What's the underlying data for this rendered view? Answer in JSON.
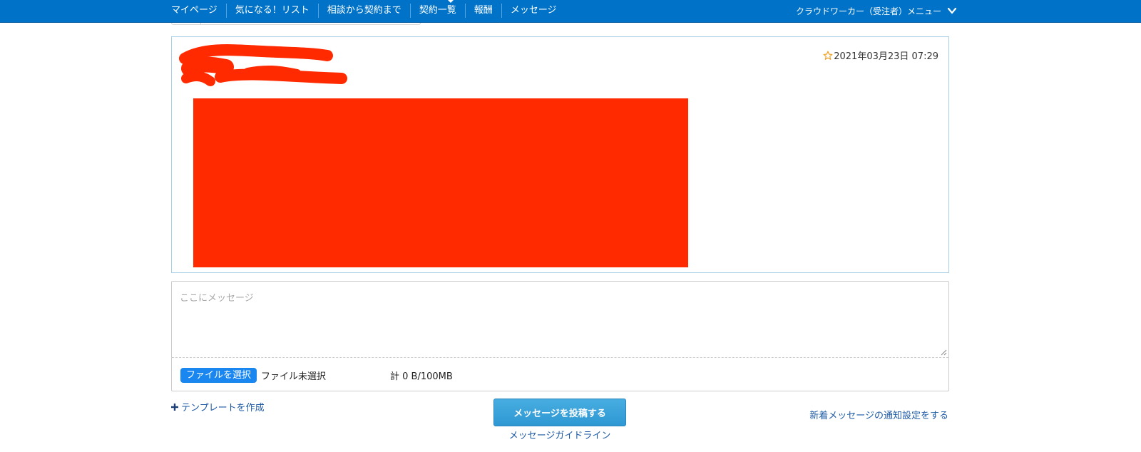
{
  "nav": {
    "items": [
      {
        "label": "マイページ"
      },
      {
        "label": "気になる！リスト"
      },
      {
        "label": "相談から契約まで"
      },
      {
        "label": "契約一覧"
      },
      {
        "label": "報酬"
      },
      {
        "label": "メッセージ"
      }
    ],
    "user_menu_label": "クラウドワーカー（受注者）メニュー"
  },
  "message": {
    "timestamp": "2021年03月23日 07:29",
    "redaction_color": "#ff2a00"
  },
  "composer": {
    "placeholder": "ここにメッセージ",
    "file_button_label": "ファイルを選択",
    "file_status": "ファイル未選択",
    "total_label": "計 0 B/100MB"
  },
  "actions": {
    "template_link": "テンプレートを作成",
    "post_button": "メッセージを投稿する",
    "guideline_link": "メッセージガイドライン",
    "notify_link": "新着メッセージの通知設定をする"
  },
  "colors": {
    "navbar": "#0073c8",
    "accent": "#2f98d3",
    "link": "#1d5aa5"
  }
}
